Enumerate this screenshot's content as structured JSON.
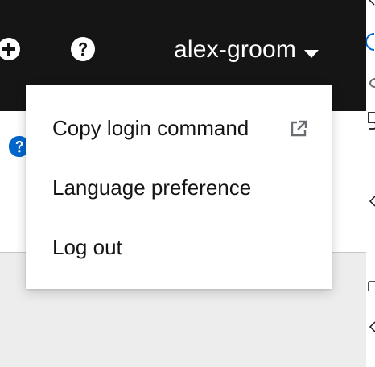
{
  "masthead": {
    "username": "alex-groom",
    "icons": {
      "add": "plus-circle-icon",
      "help": "question-circle-icon",
      "caret": "caret-down-icon"
    },
    "colors": {
      "background": "#151515",
      "text": "#ffffff"
    }
  },
  "user_menu": {
    "items": [
      {
        "label": "Copy login command",
        "icon": "external-link-icon"
      },
      {
        "label": "Language preference"
      },
      {
        "label": "Log out"
      }
    ]
  },
  "content": {
    "help_icon_color": "#0066cc"
  }
}
